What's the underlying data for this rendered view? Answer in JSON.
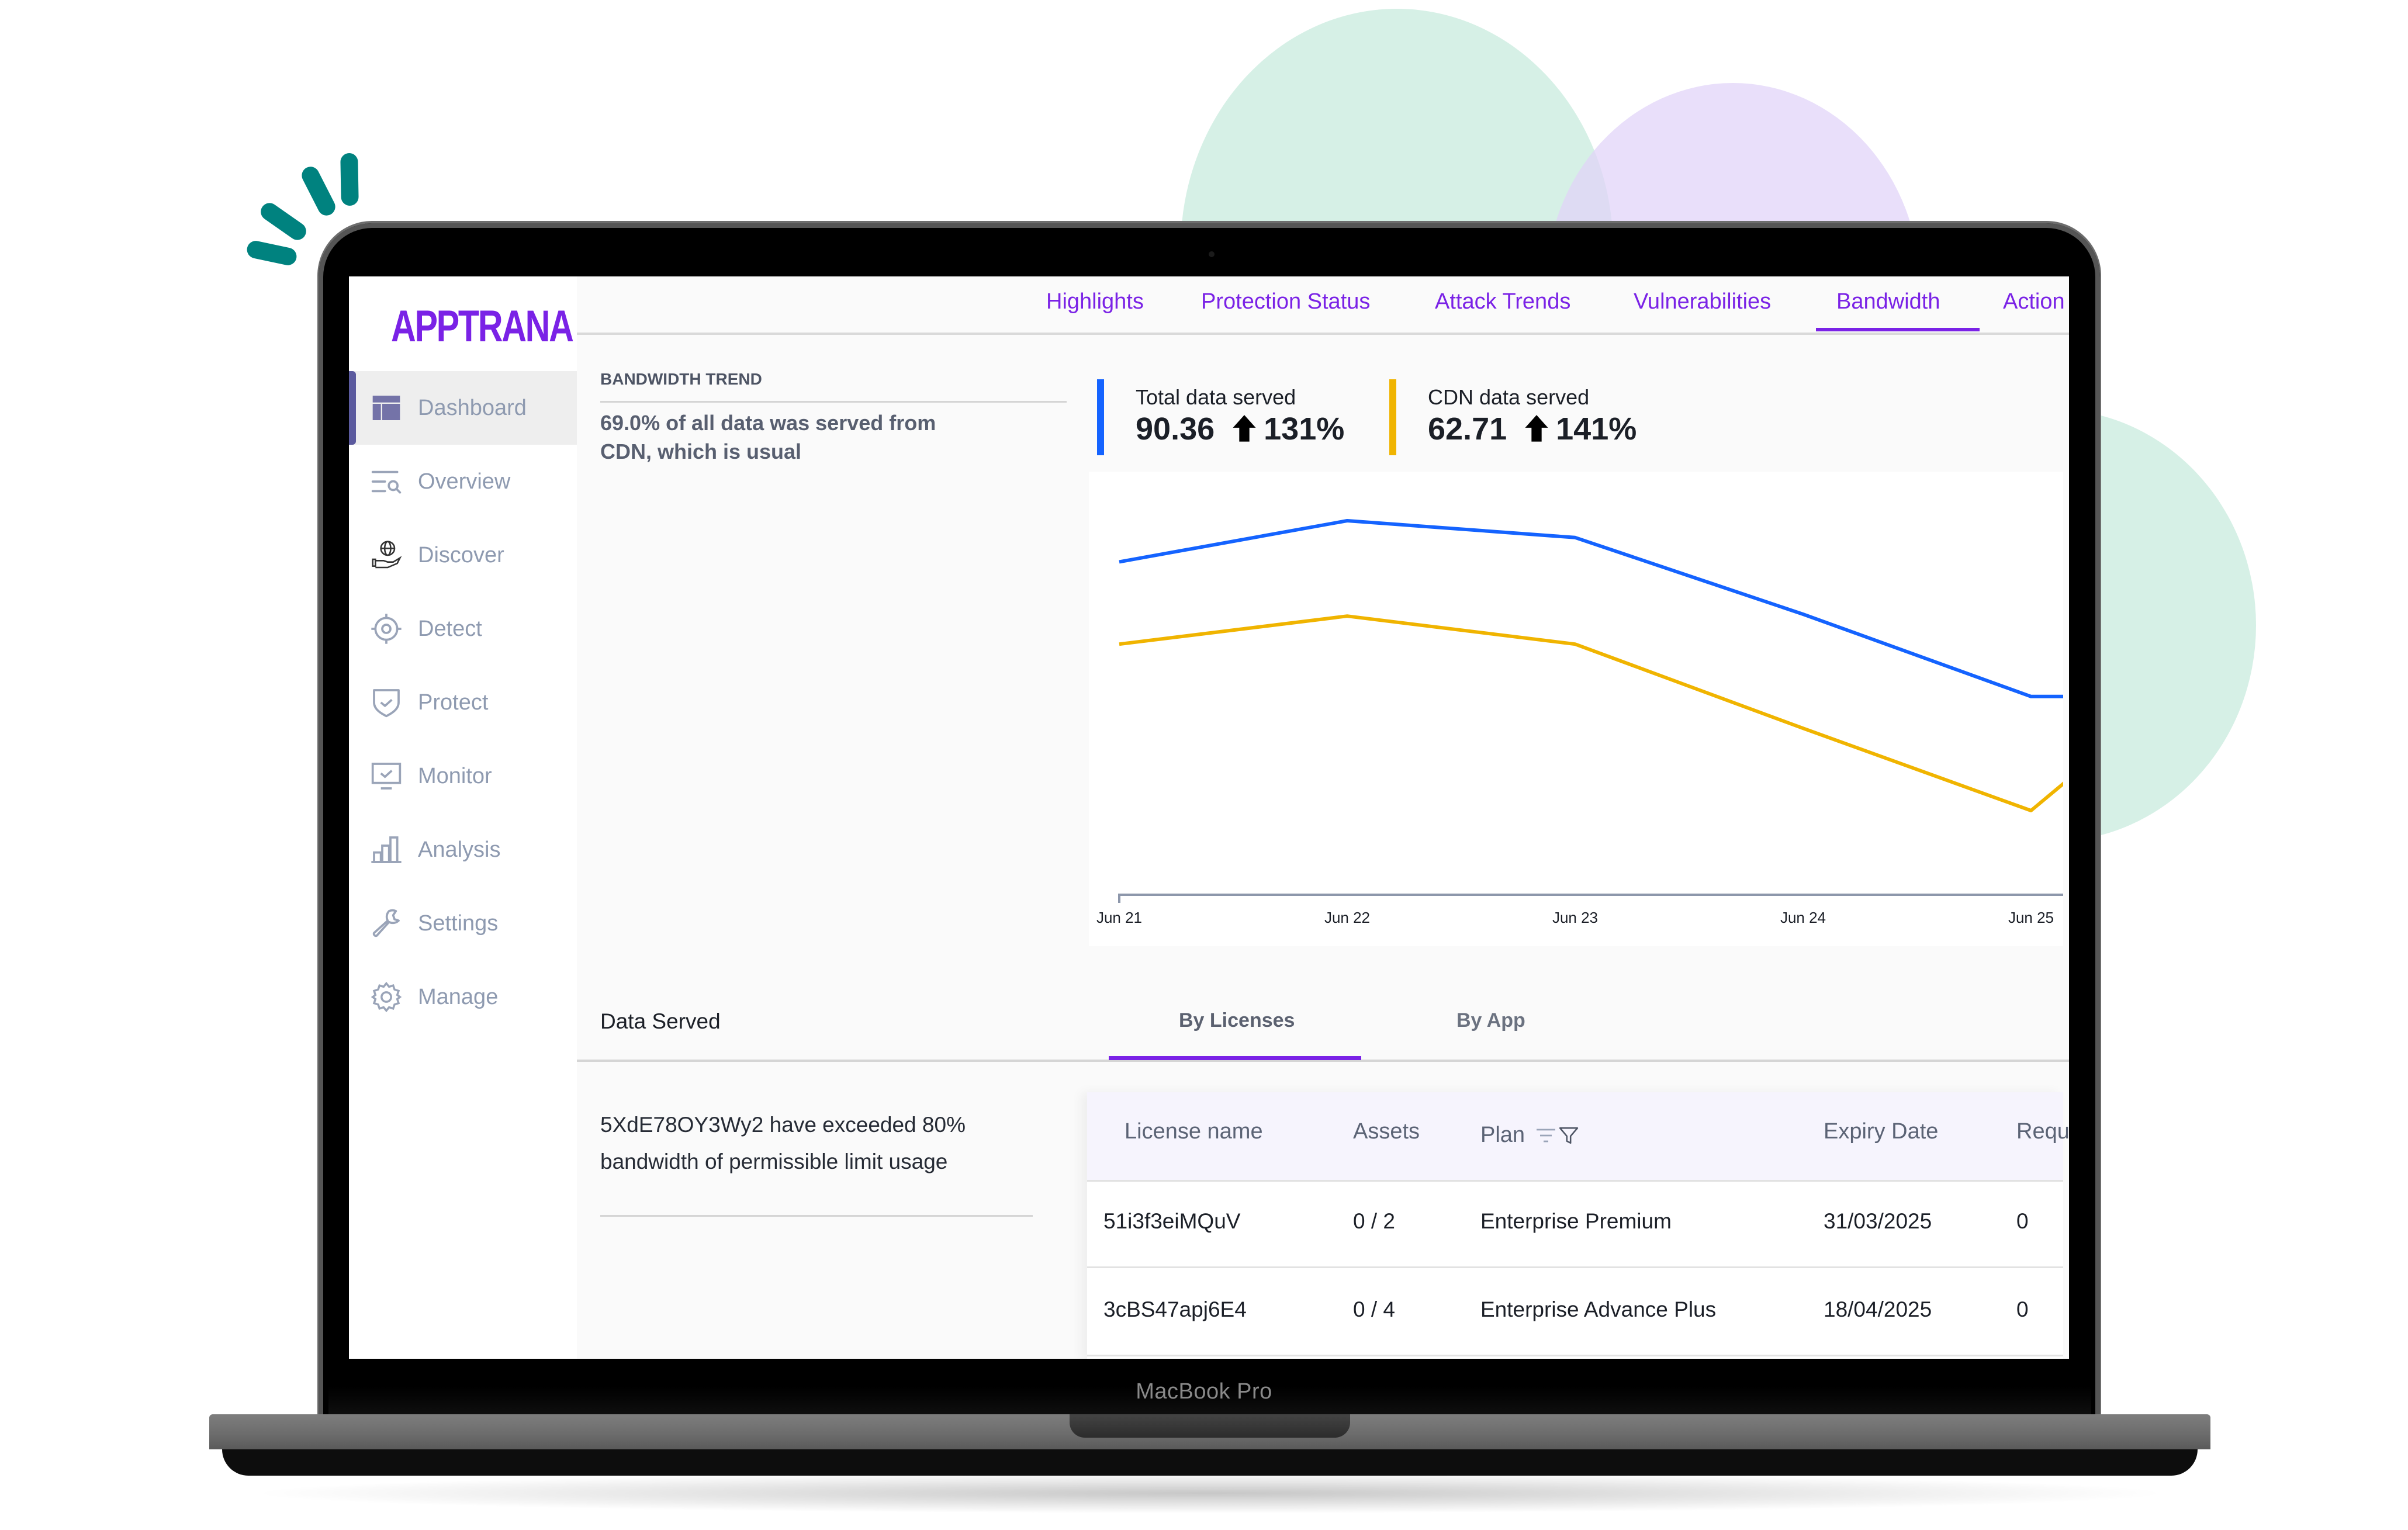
{
  "device": {
    "label": "MacBook Pro"
  },
  "brand": {
    "logo": "APPTRANA",
    "accent": "#7a22e6"
  },
  "sidebar": {
    "items": [
      {
        "label": "Dashboard",
        "icon": "dashboard-icon",
        "active": true
      },
      {
        "label": "Overview",
        "icon": "overview-search-icon",
        "active": false
      },
      {
        "label": "Discover",
        "icon": "globe-hand-icon",
        "active": false
      },
      {
        "label": "Detect",
        "icon": "target-icon",
        "active": false
      },
      {
        "label": "Protect",
        "icon": "shield-check-icon",
        "active": false
      },
      {
        "label": "Monitor",
        "icon": "monitor-check-icon",
        "active": false
      },
      {
        "label": "Analysis",
        "icon": "bar-chart-icon",
        "active": false
      },
      {
        "label": "Settings",
        "icon": "wrench-icon",
        "active": false
      },
      {
        "label": "Manage",
        "icon": "gear-icon",
        "active": false
      }
    ]
  },
  "tabs": {
    "items": [
      {
        "label": "Highlights"
      },
      {
        "label": "Protection Status"
      },
      {
        "label": "Attack Trends"
      },
      {
        "label": "Vulnerabilities"
      },
      {
        "label": "Bandwidth"
      },
      {
        "label": "Action"
      }
    ],
    "active": "Bandwidth"
  },
  "bandwidth": {
    "title": "BANDWIDTH TREND",
    "summary": "69.0% of all data was served from CDN, which is usual",
    "kpis": [
      {
        "label": "Total data served",
        "value": "90.36",
        "change": "131%",
        "direction": "up",
        "color": "#1463ff"
      },
      {
        "label": "CDN data served",
        "value": "62.71",
        "change": "141%",
        "direction": "up",
        "color": "#f0b400"
      }
    ]
  },
  "chart_data": {
    "type": "line",
    "title": "",
    "xlabel": "",
    "ylabel": "",
    "categories": [
      "Jun 21",
      "Jun 22",
      "Jun 23",
      "Jun 24",
      "Jun 25"
    ],
    "series": [
      {
        "name": "Total data served",
        "color": "#1463ff",
        "values": [
          89,
          100,
          95.5,
          75,
          53
        ]
      },
      {
        "name": "CDN data served",
        "color": "#f0b400",
        "values": [
          67,
          74.5,
          67,
          44.5,
          22.5
        ]
      }
    ],
    "ylim": [
      0,
      110
    ],
    "grid": false,
    "legend": "none",
    "y_axis_visible": false
  },
  "data_served": {
    "title": "Data Served",
    "subtabs": [
      {
        "label": "By Licenses",
        "active": true
      },
      {
        "label": "By App",
        "active": false
      }
    ],
    "alert": "5XdE78OY3Wy2 have exceeded 80% bandwidth of permissible limit usage"
  },
  "table": {
    "columns": [
      "License name",
      "Assets",
      "Plan",
      "Expiry Date",
      "Requ"
    ],
    "rows": [
      [
        "51i3f3eiMQuV",
        "0 / 2",
        "Enterprise Premium",
        "31/03/2025",
        "0"
      ],
      [
        "3cBS47apj6E4",
        "0 / 4",
        "Enterprise Advance Plus",
        "18/04/2025",
        "0"
      ]
    ]
  }
}
